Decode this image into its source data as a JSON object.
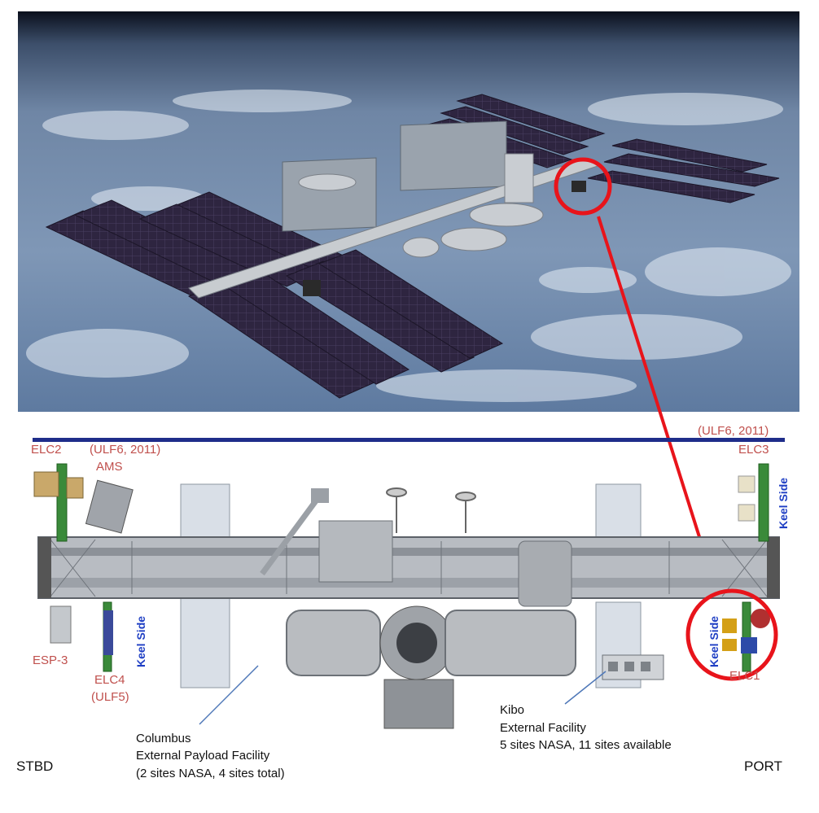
{
  "labels": {
    "elc2": "ELC2",
    "ulf6_left": "(ULF6, 2011)",
    "ams": "AMS",
    "ulf6_right": "(ULF6, 2011)",
    "elc3": "ELC3",
    "keel_side_elc3": "Keel Side",
    "keel_side_elc4": "Keel Side",
    "keel_side_elc1": "Keel Side",
    "esp3": "ESP-3",
    "elc4": "ELC4",
    "ulf5": "(ULF5)",
    "elc1": "ELC1",
    "columbus_line1": "Columbus",
    "columbus_line2": "External Payload Facility",
    "columbus_line3": "(2 sites NASA, 4 sites total)",
    "kibo_line1": "Kibo",
    "kibo_line2": "External Facility",
    "kibo_line3": "5 sites NASA, 11 sites available",
    "stbd": "STBD",
    "port": "PORT"
  },
  "colors": {
    "highlight_circle": "#e8141b",
    "label_red": "#c0504d",
    "label_blue": "#1f3fc4",
    "top_bar": "#1f2d8a",
    "solar_panel": "#2f2440"
  }
}
